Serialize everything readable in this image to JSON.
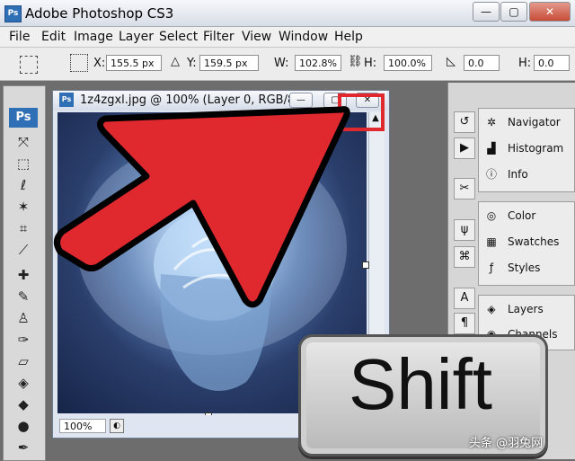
{
  "app": {
    "title": "Adobe Photoshop CS3",
    "logo": "Ps"
  },
  "window_controls": {
    "minimize": "—",
    "restore": "▢",
    "close": "✕"
  },
  "menu": [
    "File",
    "Edit",
    "Image",
    "Layer",
    "Select",
    "Filter",
    "View",
    "Window",
    "Help"
  ],
  "options": {
    "x_label": "X:",
    "x_value": "155.5 px",
    "y_label": "Y:",
    "y_value": "159.5 px",
    "w_label": "W:",
    "w_value": "102.8%",
    "h_label": "H:",
    "h_value": "100.0%",
    "angle_value": "0.0",
    "h2_label": "H:",
    "h2_value": "0.0"
  },
  "toolbox": {
    "logo": "Ps",
    "tools": [
      "move-icon",
      "marquee-icon",
      "lasso-icon",
      "magic-wand-icon",
      "crop-icon",
      "slice-icon",
      "healing-brush-icon",
      "brush-icon",
      "clone-stamp-icon",
      "history-brush-icon",
      "eraser-icon",
      "paint-bucket-icon",
      "blur-icon",
      "dodge-icon",
      "pen-icon"
    ]
  },
  "document": {
    "title": "1z4zgxl.jpg @ 100% (Layer 0, RGB/8)",
    "zoom": "100%"
  },
  "panels": {
    "group1": [
      "Navigator",
      "Histogram",
      "Info"
    ],
    "group2": [
      "Color",
      "Swatches",
      "Styles"
    ],
    "group3": [
      "Layers",
      "Channels"
    ]
  },
  "overlay": {
    "key_label": "Shift",
    "arrow_color": "#e0282f",
    "highlight_color": "#e0282f"
  },
  "watermark": "头条 @羽兔网"
}
